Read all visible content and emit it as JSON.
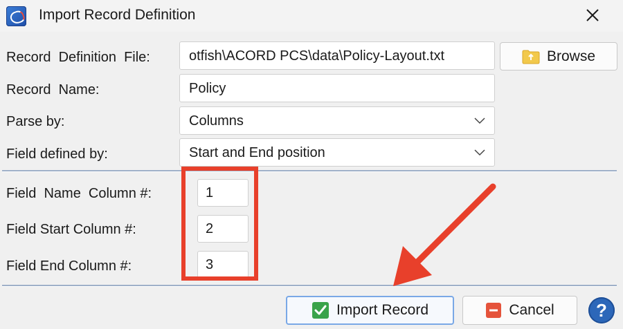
{
  "window": {
    "title": "Import Record Definition",
    "close_glyph": "✕",
    "app_icon": "app-logo-icon"
  },
  "form": {
    "file_label": "Record  Definition  File:",
    "file_value": "otfish\\ACORD PCS\\data\\Policy-Layout.txt",
    "browse_label": "Browse",
    "browse_icon": "folder-icon",
    "name_label": "Record  Name:",
    "name_value": "Policy",
    "parse_label": "Parse by:",
    "parse_value": "Columns",
    "defined_label": "Field defined by:",
    "defined_value": "Start and End position"
  },
  "columns": {
    "name_col_label": "Field  Name  Column #:",
    "name_col_value": "1",
    "start_col_label": "Field Start Column #:",
    "start_col_value": "2",
    "end_col_label": "Field End Column #:",
    "end_col_value": "3"
  },
  "footer": {
    "import_label": "Import Record",
    "import_icon": "checkmark-icon",
    "cancel_label": "Cancel",
    "cancel_icon": "cancel-icon",
    "help_glyph": "?"
  },
  "annotations": {
    "highlight_color": "#e8402b",
    "arrow_color": "#e8402b"
  }
}
